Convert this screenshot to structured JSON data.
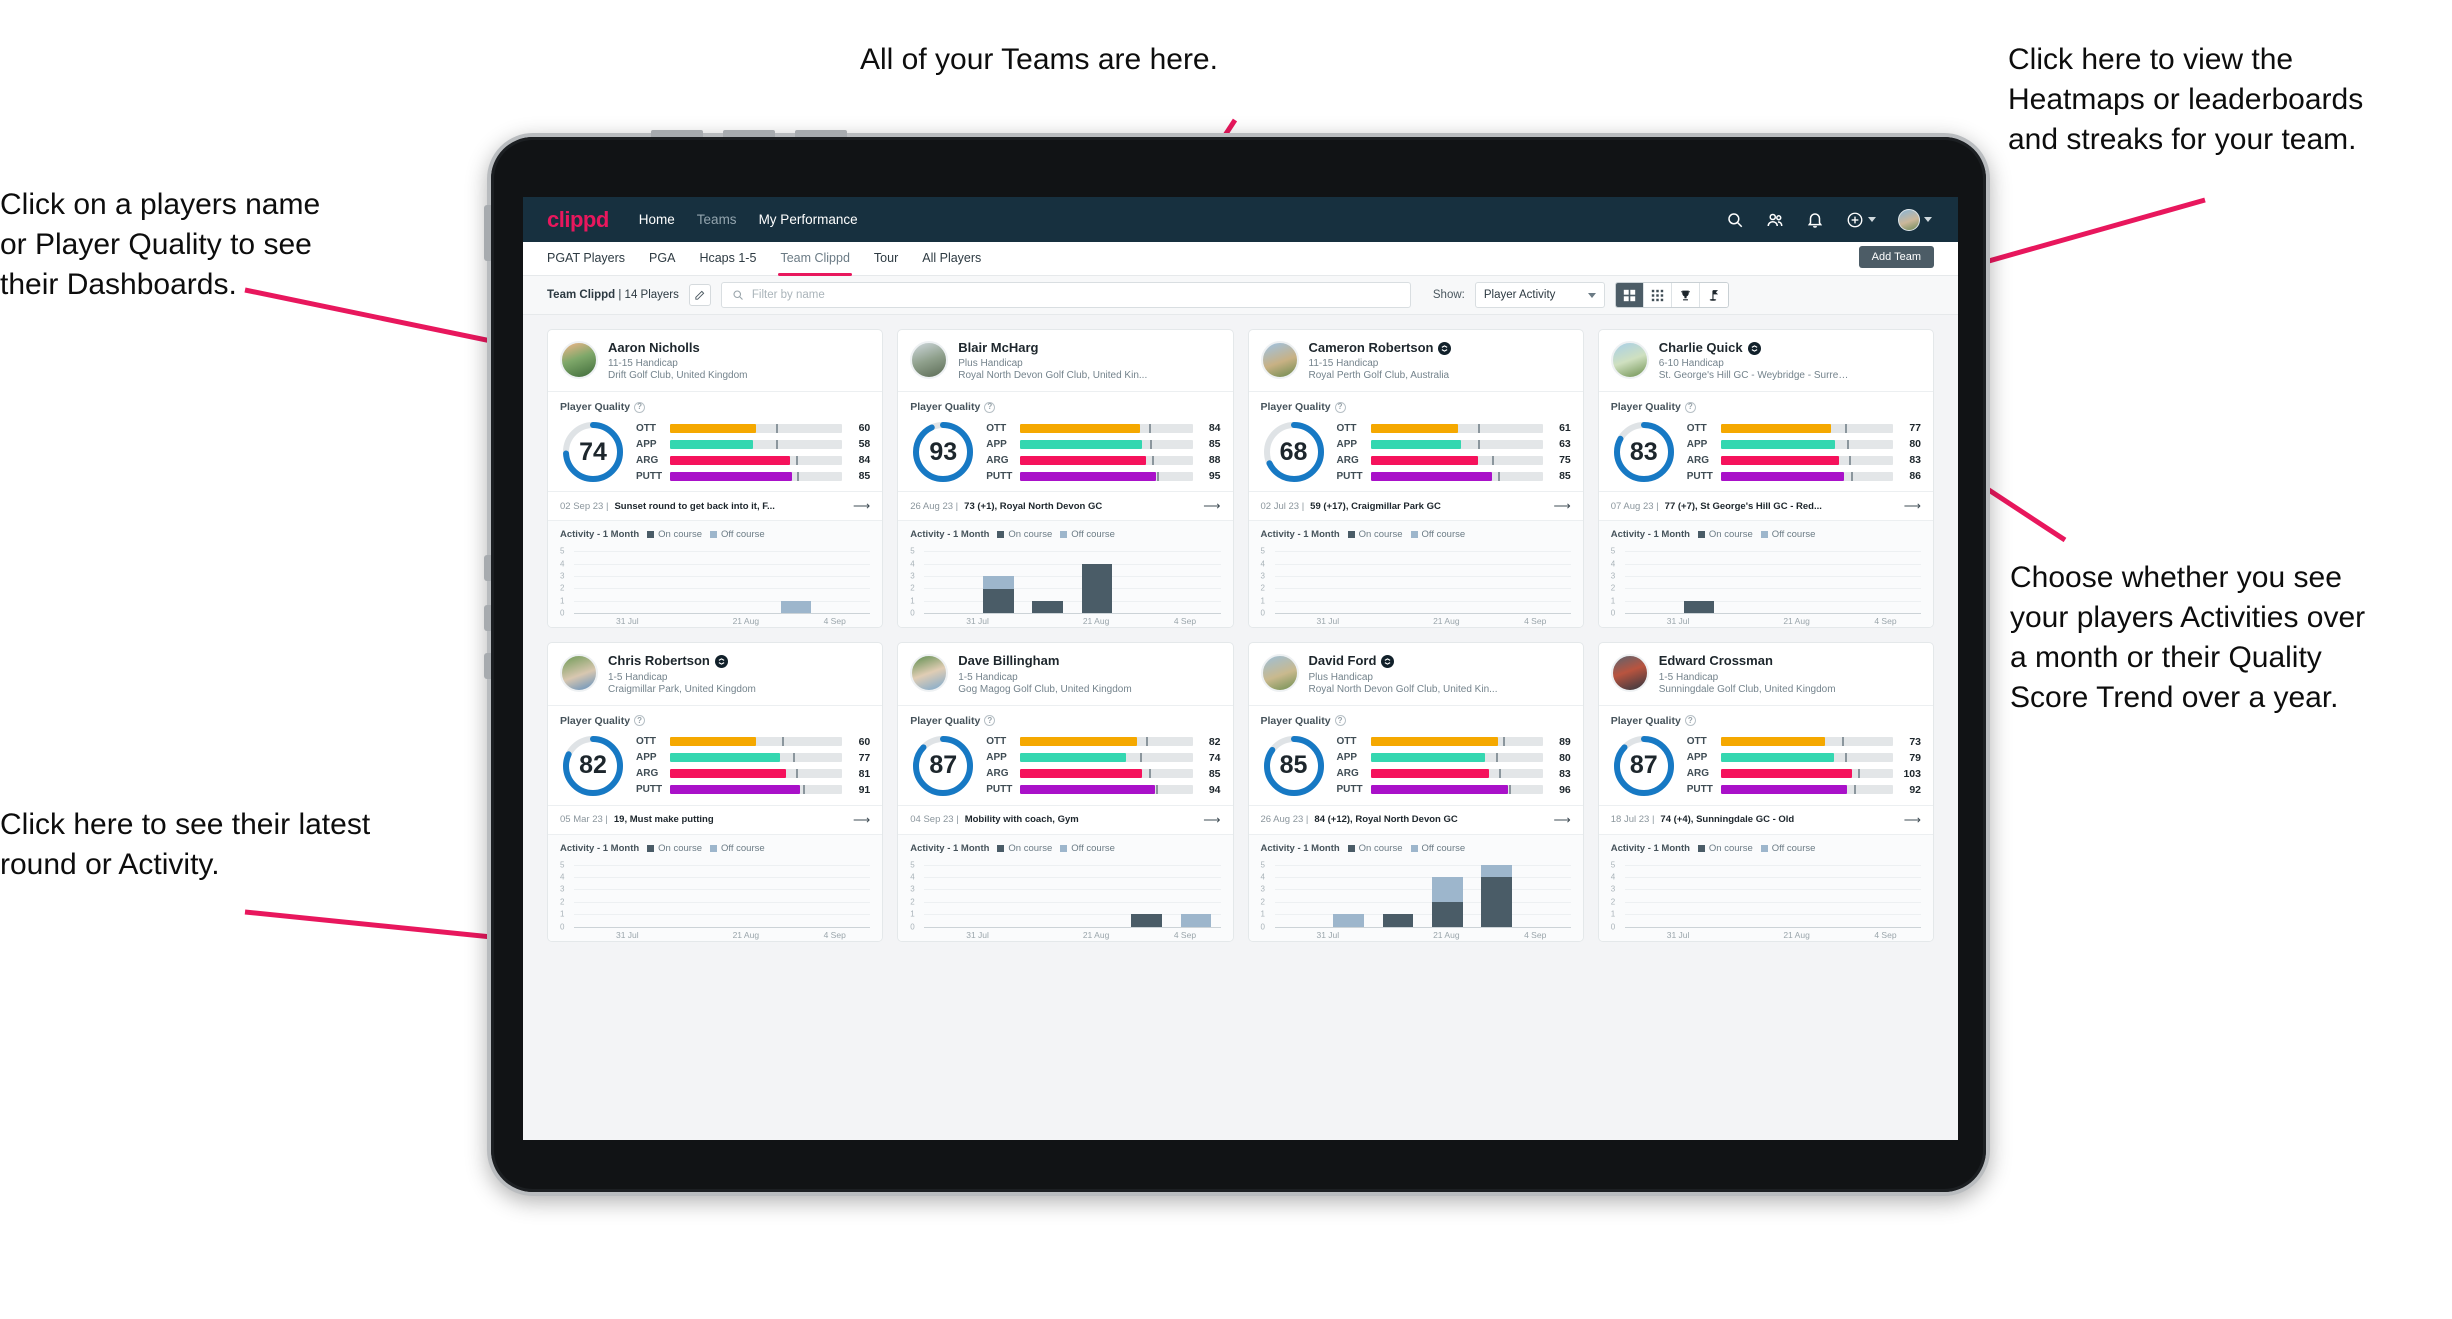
{
  "annotations": [
    {
      "id": "teams",
      "text": "All of your Teams are here."
    },
    {
      "id": "heatmaps",
      "text": "Click here to view the\nHeatmaps or leaderboards\nand streaks for your team."
    },
    {
      "id": "players",
      "text": "Click on a players name\nor Player Quality to see\ntheir Dashboards."
    },
    {
      "id": "activity",
      "text": "Choose whether you see\nyour players Activities over\na month or their Quality\nScore Trend over a year."
    },
    {
      "id": "latest",
      "text": "Click here to see their latest\nround or Activity."
    }
  ],
  "app": {
    "brand": "clippd",
    "nav": [
      {
        "label": "Home",
        "active": true
      },
      {
        "label": "Teams",
        "active": false
      },
      {
        "label": "My Performance",
        "active": true
      }
    ],
    "nav_icons": [
      "search-icon",
      "people-icon",
      "bell-icon",
      "plus-circle-icon",
      "avatar"
    ],
    "tabs": [
      {
        "label": "PGAT Players",
        "active": false
      },
      {
        "label": "PGA",
        "active": false
      },
      {
        "label": "Hcaps 1-5",
        "active": false
      },
      {
        "label": "Team Clippd",
        "active": true
      },
      {
        "label": "Tour",
        "active": false
      },
      {
        "label": "All Players",
        "active": false
      }
    ],
    "add_team_label": "Add Team",
    "toolbar": {
      "team_name": "Team Clippd",
      "team_count": "14 Players",
      "edit_icon": "pencil-icon",
      "search_placeholder": "Filter by name",
      "show_label": "Show:",
      "show_value": "Player Activity",
      "views": [
        {
          "name": "grid-view-icon",
          "active": true
        },
        {
          "name": "dots-grid-view-icon",
          "active": false
        },
        {
          "name": "trophy-view-icon",
          "active": false
        },
        {
          "name": "flag-view-icon",
          "active": false
        }
      ]
    },
    "labels": {
      "player_quality": "Player Quality",
      "activity_title": "Activity - 1 Month",
      "legend_on": "On course",
      "legend_off": "Off course"
    },
    "colors": {
      "brand_pink": "#e8175d",
      "nav_dark": "#17303f",
      "ring_blue": "#1779c4",
      "ott": "#f5a800",
      "app": "#34d7b0",
      "arg": "#f5125c",
      "putt": "#a911c9",
      "on_course": "#4a5c67",
      "off_course": "#9db6cc"
    }
  },
  "chart_data": {
    "type": "bar",
    "title": "Activity - 1 Month",
    "ylim": [
      0,
      5
    ],
    "yticks": [
      5,
      4,
      3,
      2,
      1,
      0
    ],
    "xlabels": [
      "31 Jul",
      "21 Aug",
      "4 Sep"
    ],
    "series": [
      "On course",
      "Off course"
    ]
  },
  "players": [
    {
      "name": "Aaron Nicholls",
      "verified": false,
      "handicap": "11-15 Handicap",
      "club": "Drift Golf Club, United Kingdom",
      "quality": 74,
      "metrics": [
        {
          "label": "OTT",
          "value": 60,
          "fill": 60,
          "tick": 74
        },
        {
          "label": "APP",
          "value": 58,
          "fill": 58,
          "tick": 74
        },
        {
          "label": "ARG",
          "value": 84,
          "fill": 84,
          "tick": 88
        },
        {
          "label": "PUTT",
          "value": 85,
          "fill": 85,
          "tick": 89
        }
      ],
      "round_date": "02 Sep 23",
      "round_desc": "Sunset round to get back into it, F...",
      "activity": [
        {
          "on": 0,
          "off": 0
        },
        {
          "on": 0,
          "off": 0
        },
        {
          "on": 0,
          "off": 0
        },
        {
          "on": 0,
          "off": 0
        },
        {
          "on": 0,
          "off": 1
        },
        {
          "on": 0,
          "off": 0
        }
      ]
    },
    {
      "name": "Blair McHarg",
      "verified": false,
      "handicap": "Plus Handicap",
      "club": "Royal North Devon Golf Club, United Kin...",
      "quality": 93,
      "metrics": [
        {
          "label": "OTT",
          "value": 84,
          "fill": 84,
          "tick": 90
        },
        {
          "label": "APP",
          "value": 85,
          "fill": 85,
          "tick": 91
        },
        {
          "label": "ARG",
          "value": 88,
          "fill": 88,
          "tick": 92
        },
        {
          "label": "PUTT",
          "value": 95,
          "fill": 95,
          "tick": 96
        }
      ],
      "round_date": "26 Aug 23",
      "round_desc": "73 (+1), Royal North Devon GC",
      "activity": [
        {
          "on": 0,
          "off": 0
        },
        {
          "on": 2,
          "off": 1
        },
        {
          "on": 1,
          "off": 0
        },
        {
          "on": 4,
          "off": 0
        },
        {
          "on": 0,
          "off": 0
        },
        {
          "on": 0,
          "off": 0
        }
      ]
    },
    {
      "name": "Cameron Robertson",
      "verified": true,
      "handicap": "11-15 Handicap",
      "club": "Royal Perth Golf Club, Australia",
      "quality": 68,
      "metrics": [
        {
          "label": "OTT",
          "value": 61,
          "fill": 61,
          "tick": 75
        },
        {
          "label": "APP",
          "value": 63,
          "fill": 63,
          "tick": 75
        },
        {
          "label": "ARG",
          "value": 75,
          "fill": 75,
          "tick": 85
        },
        {
          "label": "PUTT",
          "value": 85,
          "fill": 85,
          "tick": 89
        }
      ],
      "round_date": "02 Jul 23",
      "round_desc": "59 (+17), Craigmillar Park GC",
      "activity": [
        {
          "on": 0,
          "off": 0
        },
        {
          "on": 0,
          "off": 0
        },
        {
          "on": 0,
          "off": 0
        },
        {
          "on": 0,
          "off": 0
        },
        {
          "on": 0,
          "off": 0
        },
        {
          "on": 0,
          "off": 0
        }
      ]
    },
    {
      "name": "Charlie Quick",
      "verified": true,
      "handicap": "6-10 Handicap",
      "club": "St. George's Hill GC - Weybridge - Surrey, ...",
      "quality": 83,
      "metrics": [
        {
          "label": "OTT",
          "value": 77,
          "fill": 77,
          "tick": 87
        },
        {
          "label": "APP",
          "value": 80,
          "fill": 80,
          "tick": 88
        },
        {
          "label": "ARG",
          "value": 83,
          "fill": 83,
          "tick": 90
        },
        {
          "label": "PUTT",
          "value": 86,
          "fill": 86,
          "tick": 91
        }
      ],
      "round_date": "07 Aug 23",
      "round_desc": "77 (+7), St George's Hill GC - Red...",
      "activity": [
        {
          "on": 0,
          "off": 0
        },
        {
          "on": 1,
          "off": 0
        },
        {
          "on": 0,
          "off": 0
        },
        {
          "on": 0,
          "off": 0
        },
        {
          "on": 0,
          "off": 0
        },
        {
          "on": 0,
          "off": 0
        }
      ]
    },
    {
      "name": "Chris Robertson",
      "verified": true,
      "handicap": "1-5 Handicap",
      "club": "Craigmillar Park, United Kingdom",
      "quality": 82,
      "metrics": [
        {
          "label": "OTT",
          "value": 60,
          "fill": 60,
          "tick": 78
        },
        {
          "label": "APP",
          "value": 77,
          "fill": 77,
          "tick": 86
        },
        {
          "label": "ARG",
          "value": 81,
          "fill": 81,
          "tick": 88
        },
        {
          "label": "PUTT",
          "value": 91,
          "fill": 91,
          "tick": 93
        }
      ],
      "round_date": "05 Mar 23",
      "round_desc": "19, Must make putting",
      "activity": [
        {
          "on": 0,
          "off": 0
        },
        {
          "on": 0,
          "off": 0
        },
        {
          "on": 0,
          "off": 0
        },
        {
          "on": 0,
          "off": 0
        },
        {
          "on": 0,
          "off": 0
        },
        {
          "on": 0,
          "off": 0
        }
      ]
    },
    {
      "name": "Dave Billingham",
      "verified": false,
      "handicap": "1-5 Handicap",
      "club": "Gog Magog Golf Club, United Kingdom",
      "quality": 87,
      "metrics": [
        {
          "label": "OTT",
          "value": 82,
          "fill": 82,
          "tick": 88
        },
        {
          "label": "APP",
          "value": 74,
          "fill": 74,
          "tick": 84
        },
        {
          "label": "ARG",
          "value": 85,
          "fill": 85,
          "tick": 90
        },
        {
          "label": "PUTT",
          "value": 94,
          "fill": 94,
          "tick": 95
        }
      ],
      "round_date": "04 Sep 23",
      "round_desc": "Mobility with coach, Gym",
      "activity": [
        {
          "on": 0,
          "off": 0
        },
        {
          "on": 0,
          "off": 0
        },
        {
          "on": 0,
          "off": 0
        },
        {
          "on": 0,
          "off": 0
        },
        {
          "on": 1,
          "off": 0
        },
        {
          "on": 0,
          "off": 1
        }
      ]
    },
    {
      "name": "David Ford",
      "verified": true,
      "handicap": "Plus Handicap",
      "club": "Royal North Devon Golf Club, United Kin...",
      "quality": 85,
      "metrics": [
        {
          "label": "OTT",
          "value": 89,
          "fill": 89,
          "tick": 93
        },
        {
          "label": "APP",
          "value": 80,
          "fill": 80,
          "tick": 88
        },
        {
          "label": "ARG",
          "value": 83,
          "fill": 83,
          "tick": 90
        },
        {
          "label": "PUTT",
          "value": 96,
          "fill": 96,
          "tick": 97
        }
      ],
      "round_date": "26 Aug 23",
      "round_desc": "84 (+12), Royal North Devon GC",
      "activity": [
        {
          "on": 0,
          "off": 0
        },
        {
          "on": 0,
          "off": 1
        },
        {
          "on": 1,
          "off": 0
        },
        {
          "on": 2,
          "off": 2
        },
        {
          "on": 4,
          "off": 1
        },
        {
          "on": 0,
          "off": 0
        }
      ]
    },
    {
      "name": "Edward Crossman",
      "verified": false,
      "handicap": "1-5 Handicap",
      "club": "Sunningdale Golf Club, United Kingdom",
      "quality": 87,
      "metrics": [
        {
          "label": "OTT",
          "value": 73,
          "fill": 73,
          "tick": 85
        },
        {
          "label": "APP",
          "value": 79,
          "fill": 79,
          "tick": 87
        },
        {
          "label": "ARG",
          "value": 103,
          "fill": 92,
          "tick": 96
        },
        {
          "label": "PUTT",
          "value": 92,
          "fill": 88,
          "tick": 93
        }
      ],
      "round_date": "18 Jul 23",
      "round_desc": "74 (+4), Sunningdale GC - Old",
      "activity": [
        {
          "on": 0,
          "off": 0
        },
        {
          "on": 0,
          "off": 0
        },
        {
          "on": 0,
          "off": 0
        },
        {
          "on": 0,
          "off": 0
        },
        {
          "on": 0,
          "off": 0
        },
        {
          "on": 0,
          "off": 0
        }
      ]
    }
  ]
}
